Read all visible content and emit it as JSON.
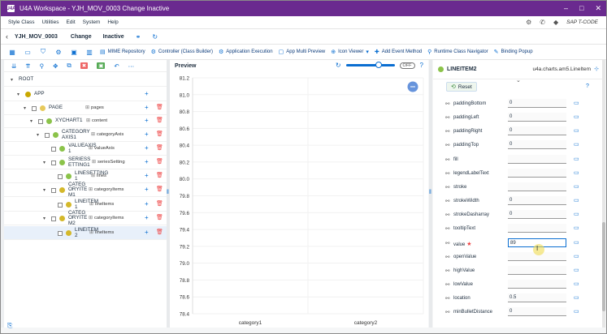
{
  "window": {
    "title": "U4A Workspace - YJH_MOV_0003 Change Inactive",
    "app_icon": "U4A",
    "controls": [
      "–",
      "□",
      "✕"
    ]
  },
  "menu": {
    "items": [
      "Style Class",
      "Utilities",
      "Edit",
      "System",
      "Help"
    ],
    "tcode": "SAP T-CODE"
  },
  "header": {
    "program": "YJH_MOV_0003",
    "mode": "Change",
    "status": "Inactive"
  },
  "toolbar": {
    "items": [
      {
        "label": "MIME Repository",
        "icon": "mime-icon"
      },
      {
        "label": "Controller (Class Builder)",
        "icon": "controller-icon"
      },
      {
        "label": "Application Execution",
        "icon": "execute-icon"
      },
      {
        "label": "App Multi Preview",
        "icon": "preview-icon"
      },
      {
        "label": "Icon Viewer",
        "icon": "icon-viewer-icon"
      },
      {
        "label": "Add Event Method",
        "icon": "add-event-icon"
      },
      {
        "label": "Runtime Class Navigator",
        "icon": "runtime-icon"
      },
      {
        "label": "Binding Popup",
        "icon": "binding-icon"
      }
    ]
  },
  "tree": {
    "rows": [
      {
        "label": "ROOT",
        "agg": ""
      },
      {
        "label": "APP",
        "agg": ""
      },
      {
        "label": "PAGE",
        "agg": "pages"
      },
      {
        "label": "XYCHART1",
        "agg": "content"
      },
      {
        "label": "CATEGORY AXIS1",
        "agg": "categoryAxis"
      },
      {
        "label": "VALUEAXIS 1",
        "agg": "valueAxis"
      },
      {
        "label": "SERIESS ETTING1",
        "agg": "seriesSetting"
      },
      {
        "label": "LINESETTING 1",
        "agg": "lines"
      },
      {
        "label": "CATEG ORYITE M1",
        "agg": "categoryItems"
      },
      {
        "label": "LINEITEM 1",
        "agg": "lineItems"
      },
      {
        "label": "CATEG ORYITE M2",
        "agg": "categoryItems"
      },
      {
        "label": "LINEITEM 2",
        "agg": "lineItems"
      }
    ]
  },
  "preview": {
    "title": "Preview",
    "toggle": "OFF"
  },
  "chart_data": {
    "type": "line",
    "categories": [
      "category1",
      "category2"
    ],
    "ylim": [
      78.4,
      81.2
    ],
    "yticks": [
      "81.2",
      "81.0",
      "80.8",
      "80.6",
      "80.4",
      "80.2",
      "80.0",
      "79.8",
      "79.6",
      "79.4",
      "79.2",
      "79.0",
      "78.8",
      "78.6",
      "78.4"
    ]
  },
  "props": {
    "title": "LINEITEM2",
    "class": "u4a.charts.am5.LineItem",
    "reset": "Reset",
    "rows": [
      {
        "label": "paddingBottom",
        "value": "0"
      },
      {
        "label": "paddingLeft",
        "value": "0"
      },
      {
        "label": "paddingRight",
        "value": "0"
      },
      {
        "label": "paddingTop",
        "value": "0"
      },
      {
        "label": "fill",
        "value": ""
      },
      {
        "label": "legendLabelText",
        "value": ""
      },
      {
        "label": "stroke",
        "value": ""
      },
      {
        "label": "strokeWidth",
        "value": "0"
      },
      {
        "label": "strokeDasharray",
        "value": "0"
      },
      {
        "label": "tooltipText",
        "value": ""
      },
      {
        "label": "value",
        "value": "89"
      },
      {
        "label": "openValue",
        "value": ""
      },
      {
        "label": "highValue",
        "value": ""
      },
      {
        "label": "lowValue",
        "value": ""
      },
      {
        "label": "location",
        "value": "0.5"
      },
      {
        "label": "minBulletDistance",
        "value": "0"
      }
    ]
  }
}
